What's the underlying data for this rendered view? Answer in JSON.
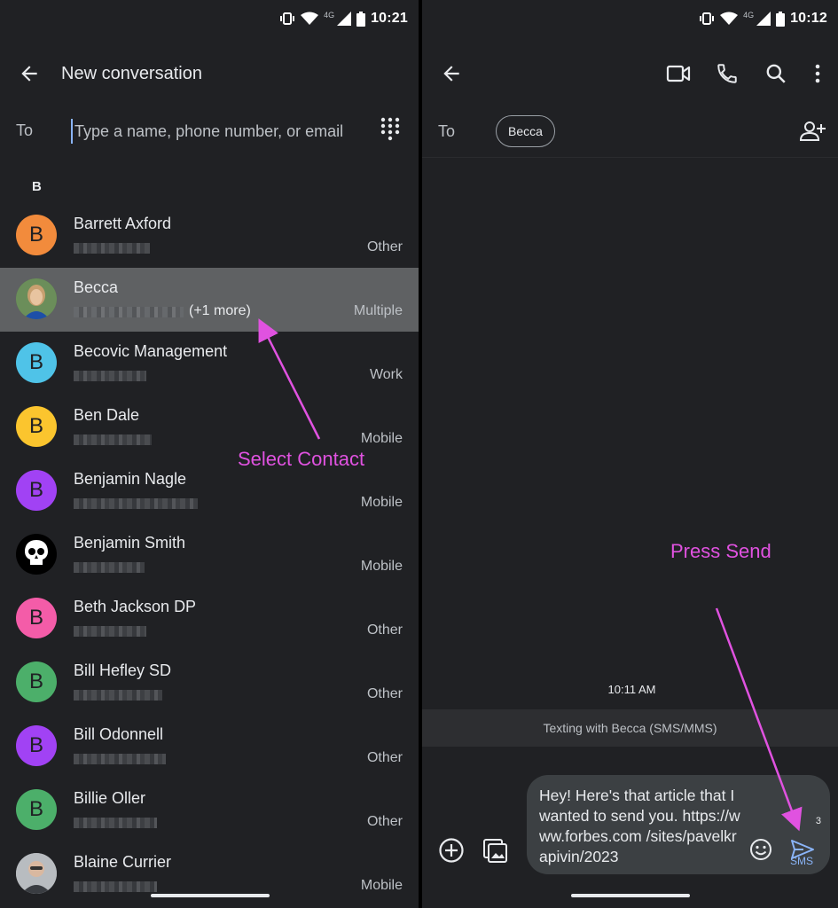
{
  "left_screen": {
    "status": {
      "network": "4G",
      "time": "10:21"
    },
    "appbar": {
      "title": "New conversation"
    },
    "to": {
      "label": "To",
      "placeholder": "Type a name, phone number, or email"
    },
    "section_letter": "B",
    "contacts": [
      {
        "name": "Barrett Axford",
        "type": "Other",
        "avatar_letter": "B",
        "avatar_color": "#f28b3c"
      },
      {
        "name": "Becca",
        "type": "Multiple",
        "more": "(+1 more)",
        "avatar_letter": "",
        "avatar_color": "#6b8e5a",
        "selected": true
      },
      {
        "name": "Becovic Management",
        "type": "Work",
        "avatar_letter": "B",
        "avatar_color": "#4fc3e8"
      },
      {
        "name": "Ben Dale",
        "type": "Mobile",
        "avatar_letter": "B",
        "avatar_color": "#fbc52e"
      },
      {
        "name": "Benjamin Nagle",
        "type": "Mobile",
        "avatar_letter": "B",
        "avatar_color": "#a142f4"
      },
      {
        "name": "Benjamin Smith",
        "type": "Mobile",
        "avatar_letter": "",
        "avatar_color": "#000000"
      },
      {
        "name": "Beth Jackson DP",
        "type": "Other",
        "avatar_letter": "B",
        "avatar_color": "#f45ca8"
      },
      {
        "name": "Bill Hefley SD",
        "type": "Other",
        "avatar_letter": "B",
        "avatar_color": "#4caf6a"
      },
      {
        "name": "Bill Odonnell",
        "type": "Other",
        "avatar_letter": "B",
        "avatar_color": "#a142f4"
      },
      {
        "name": "Billie Oller",
        "type": "Other",
        "avatar_letter": "B",
        "avatar_color": "#4caf6a"
      },
      {
        "name": "Blaine Currier",
        "type": "Mobile",
        "avatar_letter": "",
        "avatar_color": "#8a8d90"
      }
    ],
    "annotation": "Select Contact"
  },
  "right_screen": {
    "status": {
      "network": "4G",
      "time": "10:12"
    },
    "to": {
      "label": "To",
      "chip": "Becca"
    },
    "timestamp": "10:11 AM",
    "banner": "Texting with Becca (SMS/MMS)",
    "compose": {
      "text": "Hey! Here's that article that I wanted to send you. https://www.forbes.com /sites/pavelkrapivin/2023",
      "char_count": "3",
      "send_label": "SMS"
    },
    "annotation": "Press Send"
  },
  "colors": {
    "background": "#202124",
    "accent": "#8ab4f8",
    "annotation": "#e052e0",
    "selected_row": "#5f6163"
  },
  "icons": [
    "back-arrow-icon",
    "dialpad-icon",
    "video-call-icon",
    "phone-icon",
    "search-icon",
    "more-vert-icon",
    "add-person-icon",
    "add-circle-icon",
    "gallery-icon",
    "emoji-icon",
    "send-icon",
    "vibrate-icon",
    "wifi-icon",
    "signal-icon",
    "battery-icon"
  ]
}
